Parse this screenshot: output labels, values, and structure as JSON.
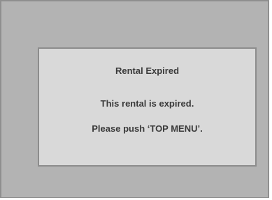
{
  "dialog": {
    "title": "Rental Expired",
    "message_line_1": "This rental is expired.",
    "message_line_2": "Please push ‘TOP MENU’."
  },
  "colors": {
    "screen_background": "#b3b3b3",
    "dialog_background": "#d9d9d9",
    "text": "#3a3a3a"
  }
}
